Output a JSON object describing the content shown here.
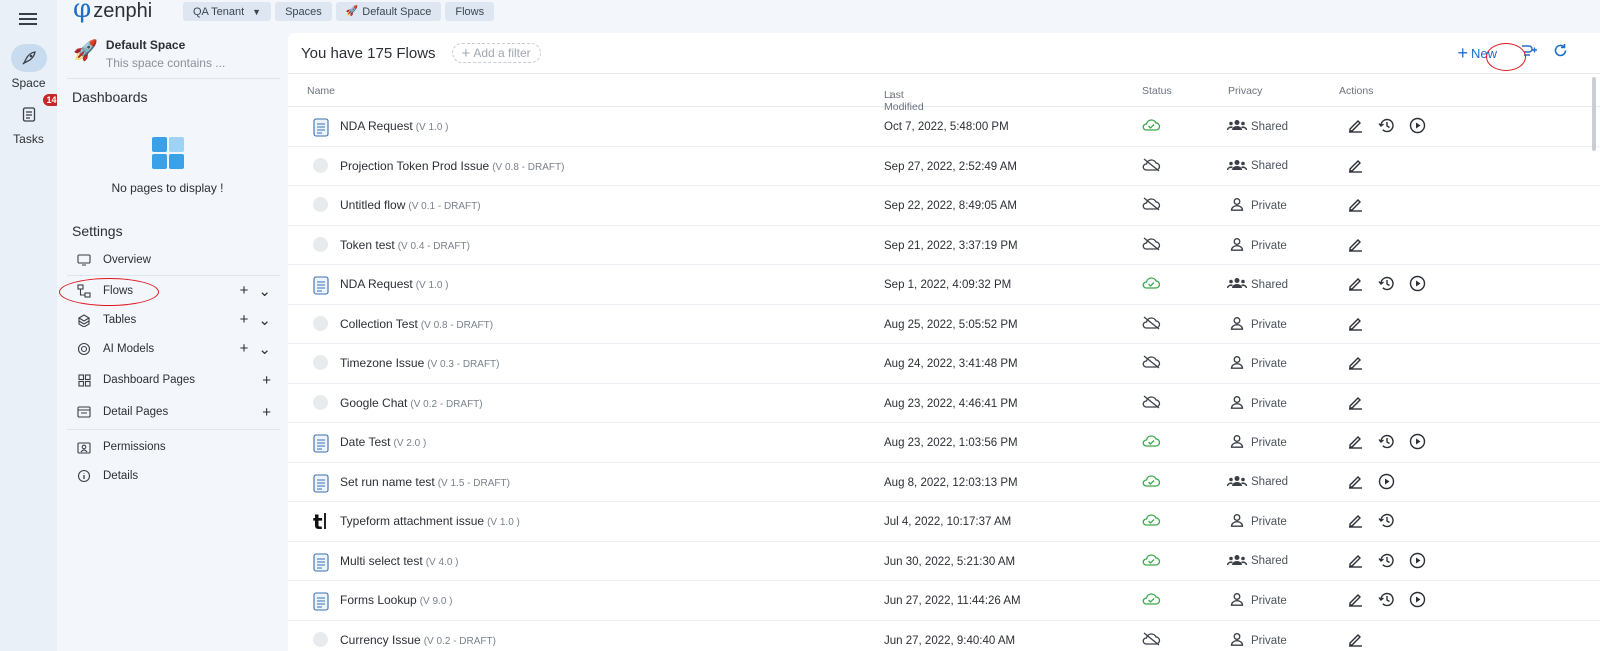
{
  "rail": {
    "space_label": "Space",
    "tasks_label": "Tasks",
    "tasks_badge": "14"
  },
  "logo": {
    "symbol": "φ",
    "word": "zenphi"
  },
  "breadcrumbs": [
    "QA Tenant",
    "Spaces",
    "Default Space",
    "Flows"
  ],
  "space": {
    "title": "Default Space",
    "subtitle": "This space contains ..."
  },
  "dashboards": {
    "title": "Dashboards",
    "empty": "No pages to display !"
  },
  "settings": {
    "title": "Settings",
    "items": [
      {
        "label": "Overview",
        "icon": "monitor-icon"
      },
      {
        "label": "Flows",
        "icon": "flow-icon"
      },
      {
        "label": "Tables",
        "icon": "tables-icon"
      },
      {
        "label": "AI Models",
        "icon": "ai-icon"
      },
      {
        "label": "Dashboard Pages",
        "icon": "dashboard-icon"
      },
      {
        "label": "Detail Pages",
        "icon": "detail-icon"
      },
      {
        "label": "Permissions",
        "icon": "permissions-icon"
      },
      {
        "label": "Details",
        "icon": "info-icon"
      }
    ]
  },
  "main": {
    "count_text": "You have 175 Flows",
    "filter_label": "Add a filter",
    "new_label": "New",
    "columns": {
      "name": "Name",
      "modified": "Last Modified",
      "status": "Status",
      "privacy": "Privacy",
      "actions": "Actions"
    },
    "rows": [
      {
        "name": "NDA Request",
        "version": "(V 1.0 )",
        "date": "Oct 7, 2022, 5:48:00 PM",
        "synced": true,
        "privacy": "Shared",
        "icon": "doc",
        "actions": [
          "edit",
          "history",
          "run"
        ]
      },
      {
        "name": "Projection Token Prod Issue",
        "version": "(V 0.8 - DRAFT)",
        "date": "Sep 27, 2022, 2:52:49 AM",
        "synced": false,
        "privacy": "Shared",
        "icon": "draft",
        "actions": [
          "edit"
        ]
      },
      {
        "name": "Untitled flow",
        "version": "(V 0.1 - DRAFT)",
        "date": "Sep 22, 2022, 8:49:05 AM",
        "synced": false,
        "privacy": "Private",
        "icon": "draft",
        "actions": [
          "edit"
        ]
      },
      {
        "name": "Token test",
        "version": "(V 0.4 - DRAFT)",
        "date": "Sep 21, 2022, 3:37:19 PM",
        "synced": false,
        "privacy": "Private",
        "icon": "draft",
        "actions": [
          "edit"
        ]
      },
      {
        "name": "NDA Request",
        "version": "(V 1.0 )",
        "date": "Sep 1, 2022, 4:09:32 PM",
        "synced": true,
        "privacy": "Shared",
        "icon": "doc",
        "actions": [
          "edit",
          "history",
          "run"
        ]
      },
      {
        "name": "Collection Test",
        "version": "(V 0.8 - DRAFT)",
        "date": "Aug 25, 2022, 5:05:52 PM",
        "synced": false,
        "privacy": "Private",
        "icon": "draft",
        "actions": [
          "edit"
        ]
      },
      {
        "name": "Timezone Issue",
        "version": "(V 0.3 - DRAFT)",
        "date": "Aug 24, 2022, 3:41:48 PM",
        "synced": false,
        "privacy": "Private",
        "icon": "draft",
        "actions": [
          "edit"
        ]
      },
      {
        "name": "Google Chat",
        "version": "(V 0.2 - DRAFT)",
        "date": "Aug 23, 2022, 4:46:41 PM",
        "synced": false,
        "privacy": "Private",
        "icon": "draft",
        "actions": [
          "edit"
        ]
      },
      {
        "name": "Date Test",
        "version": "(V 2.0 )",
        "date": "Aug 23, 2022, 1:03:56 PM",
        "synced": true,
        "privacy": "Private",
        "icon": "doc",
        "actions": [
          "edit",
          "history",
          "run"
        ]
      },
      {
        "name": "Set run name test",
        "version": "(V 1.5 - DRAFT)",
        "date": "Aug 8, 2022, 12:03:13 PM",
        "synced": true,
        "privacy": "Shared",
        "icon": "doc",
        "actions": [
          "edit",
          "run"
        ]
      },
      {
        "name": "Typeform attachment issue",
        "version": "(V 1.0 )",
        "date": "Jul 4, 2022, 10:17:37 AM",
        "synced": true,
        "privacy": "Private",
        "icon": "typeform",
        "actions": [
          "edit",
          "history"
        ]
      },
      {
        "name": "Multi select test",
        "version": "(V 4.0 )",
        "date": "Jun 30, 2022, 5:21:30 AM",
        "synced": true,
        "privacy": "Shared",
        "icon": "doc",
        "actions": [
          "edit",
          "history",
          "run"
        ]
      },
      {
        "name": "Forms Lookup",
        "version": "(V 9.0 )",
        "date": "Jun 27, 2022, 11:44:26 AM",
        "synced": true,
        "privacy": "Private",
        "icon": "doc",
        "actions": [
          "edit",
          "history",
          "run"
        ]
      },
      {
        "name": "Currency Issue",
        "version": "(V 0.2 - DRAFT)",
        "date": "Jun 27, 2022, 9:40:40 AM",
        "synced": false,
        "privacy": "Private",
        "icon": "draft",
        "actions": [
          "edit"
        ]
      }
    ]
  },
  "colors": {
    "accent": "#1e6ec8",
    "synced": "#3aa84a",
    "badge": "#c62828",
    "annotation": "#e0151b"
  }
}
